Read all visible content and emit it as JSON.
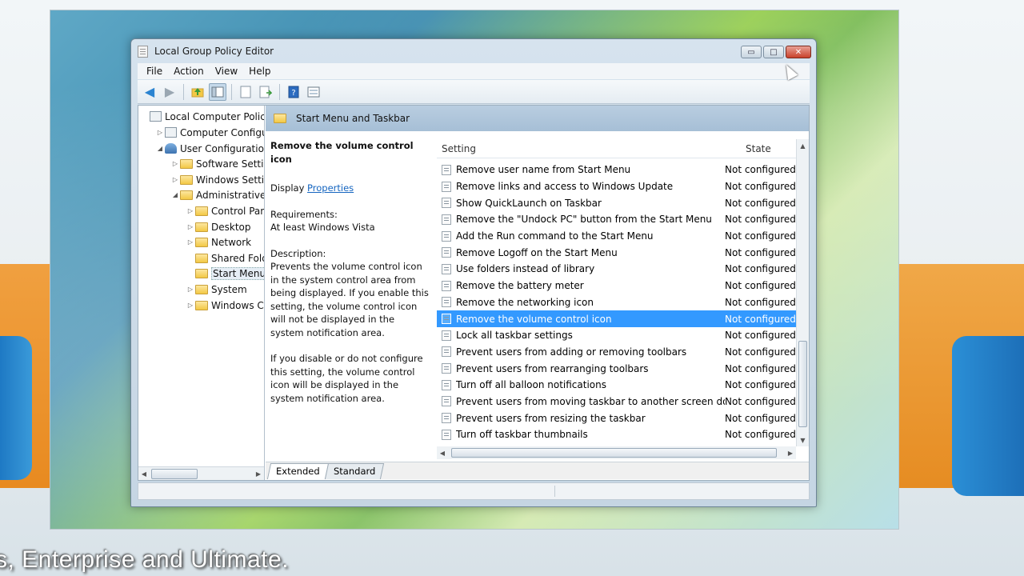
{
  "caption": "s, Enterprise and Ultimate.",
  "window": {
    "title": "Local Group Policy Editor",
    "buttons": {
      "minimize": "▭",
      "maximize": "□",
      "close": "✕"
    }
  },
  "menu": [
    "File",
    "Action",
    "View",
    "Help"
  ],
  "toolbar_icons": [
    "back-arrow-icon",
    "forward-arrow-icon",
    "up-folder-icon",
    "show-hide-tree-icon",
    "properties-icon",
    "export-list-icon",
    "help-icon",
    "view-icon"
  ],
  "tree": {
    "items": [
      {
        "label": "Local Computer Policy",
        "indent": 0,
        "toggle": "",
        "icon": "pc"
      },
      {
        "label": "Computer Configura",
        "indent": 1,
        "toggle": "▷",
        "icon": "pc"
      },
      {
        "label": "User Configuration",
        "indent": 1,
        "toggle": "◢",
        "icon": "user"
      },
      {
        "label": "Software Settings",
        "indent": 2,
        "toggle": "▷",
        "icon": "folder"
      },
      {
        "label": "Windows Setting",
        "indent": 2,
        "toggle": "▷",
        "icon": "folder"
      },
      {
        "label": "Administrative Te",
        "indent": 2,
        "toggle": "◢",
        "icon": "folder"
      },
      {
        "label": "Control Panel",
        "indent": 3,
        "toggle": "▷",
        "icon": "folder"
      },
      {
        "label": "Desktop",
        "indent": 3,
        "toggle": "▷",
        "icon": "folder"
      },
      {
        "label": "Network",
        "indent": 3,
        "toggle": "▷",
        "icon": "folder"
      },
      {
        "label": "Shared Folder",
        "indent": 3,
        "toggle": "",
        "icon": "folder"
      },
      {
        "label": "Start Menu ar",
        "indent": 3,
        "toggle": "",
        "icon": "folder",
        "selected": true
      },
      {
        "label": "System",
        "indent": 3,
        "toggle": "▷",
        "icon": "folder"
      },
      {
        "label": "Windows Cor",
        "indent": 3,
        "toggle": "▷",
        "icon": "folder"
      }
    ]
  },
  "pane_header": "Start Menu and Taskbar",
  "description": {
    "title": "Remove the volume control icon",
    "display_prefix": "Display ",
    "display_link": "Properties",
    "requirements_label": "Requirements:",
    "requirements_value": "At least Windows Vista",
    "description_label": "Description:",
    "description_text": " Prevents the volume control icon in the system control area from being displayed. If you enable this setting, the volume control icon will not be displayed in the system notification area.",
    "description_text2": "If you disable or do not configure this setting, the volume control icon will be displayed in the system notification area."
  },
  "list": {
    "columns": {
      "setting": "Setting",
      "state": "State"
    },
    "rows": [
      {
        "setting": "Remove user name from Start Menu",
        "state": "Not configured"
      },
      {
        "setting": "Remove links and access to Windows Update",
        "state": "Not configured"
      },
      {
        "setting": "Show QuickLaunch on Taskbar",
        "state": "Not configured"
      },
      {
        "setting": "Remove the \"Undock PC\" button from the Start Menu",
        "state": "Not configured"
      },
      {
        "setting": "Add the Run command to the Start Menu",
        "state": "Not configured"
      },
      {
        "setting": "Remove Logoff on the Start Menu",
        "state": "Not configured"
      },
      {
        "setting": "Use folders instead of library",
        "state": "Not configured"
      },
      {
        "setting": "Remove the battery meter",
        "state": "Not configured"
      },
      {
        "setting": "Remove the networking icon",
        "state": "Not configured"
      },
      {
        "setting": "Remove the volume control icon",
        "state": "Not configured",
        "selected": true
      },
      {
        "setting": "Lock all taskbar settings",
        "state": "Not configured"
      },
      {
        "setting": "Prevent users from adding or removing toolbars",
        "state": "Not configured"
      },
      {
        "setting": "Prevent users from rearranging toolbars",
        "state": "Not configured"
      },
      {
        "setting": "Turn off all balloon notifications",
        "state": "Not configured"
      },
      {
        "setting": "Prevent users from moving taskbar to another screen dock l...",
        "state": "Not configured"
      },
      {
        "setting": "Prevent users from resizing the taskbar",
        "state": "Not configured"
      },
      {
        "setting": "Turn off taskbar thumbnails",
        "state": "Not configured"
      }
    ]
  },
  "tabs": [
    "Extended",
    "Standard"
  ],
  "active_tab": "Extended",
  "colors": {
    "selection": "#3399ff",
    "link": "#1565c0"
  }
}
